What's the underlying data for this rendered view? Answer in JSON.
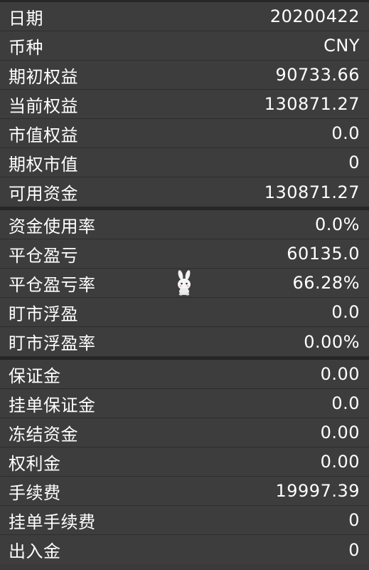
{
  "groups": [
    {
      "rows": [
        {
          "label": "日期",
          "value": "20200422"
        },
        {
          "label": "币种",
          "value": "CNY"
        },
        {
          "label": "期初权益",
          "value": "90733.66"
        },
        {
          "label": "当前权益",
          "value": "130871.27"
        },
        {
          "label": "市值权益",
          "value": "0.0"
        },
        {
          "label": "期权市值",
          "value": "0"
        },
        {
          "label": "可用资金",
          "value": "130871.27"
        }
      ]
    },
    {
      "rows": [
        {
          "label": "资金使用率",
          "value": "0.0%"
        },
        {
          "label": "平仓盈亏",
          "value": "60135.0"
        },
        {
          "label": "平仓盈亏率",
          "value": "66.28%"
        },
        {
          "label": "盯市浮盈",
          "value": "0.0"
        },
        {
          "label": "盯市浮盈率",
          "value": "0.00%"
        }
      ]
    },
    {
      "rows": [
        {
          "label": "保证金",
          "value": "0.00"
        },
        {
          "label": "挂单保证金",
          "value": "0.0"
        },
        {
          "label": "冻结资金",
          "value": "0.00"
        },
        {
          "label": "权利金",
          "value": "0.00"
        },
        {
          "label": "手续费",
          "value": "19997.39"
        },
        {
          "label": "挂单手续费",
          "value": "0"
        },
        {
          "label": "出入金",
          "value": "0"
        }
      ]
    }
  ],
  "mascot_icon": "rabbit-icon"
}
